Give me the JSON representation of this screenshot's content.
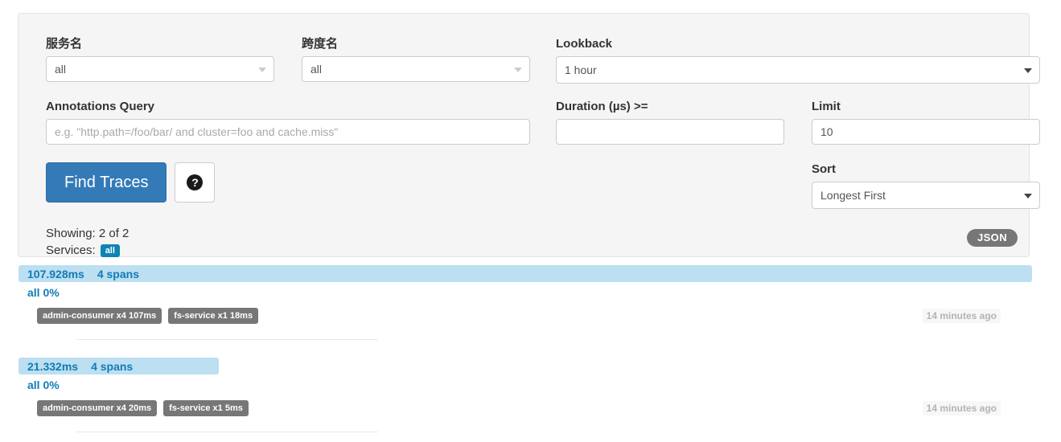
{
  "search_form": {
    "service_name": {
      "label": "服务名",
      "value": "all"
    },
    "span_name": {
      "label": "跨度名",
      "value": "all"
    },
    "lookback": {
      "label": "Lookback",
      "value": "1 hour"
    },
    "annotations_query": {
      "label": "Annotations Query",
      "value": "",
      "placeholder": "e.g. \"http.path=/foo/bar/ and cluster=foo and cache.miss\""
    },
    "duration": {
      "label": "Duration (µs) >=",
      "value": "",
      "placeholder": ""
    },
    "limit": {
      "label": "Limit",
      "value": "10"
    },
    "sort": {
      "label": "Sort",
      "value": "Longest First"
    },
    "find_traces_button": "Find Traces",
    "help_button_icon": "question-circle-icon",
    "help_button_glyph": "?"
  },
  "results_summary": {
    "showing": "Showing: 2 of 2",
    "services_label": "Services:",
    "services_badges": [
      "all"
    ],
    "json_button": "JSON"
  },
  "traces": [
    {
      "duration": "107.928ms",
      "spans": "4 spans",
      "percent_label": "all 0%",
      "services": [
        "admin-consumer x4 107ms",
        "fs-service x1 18ms"
      ],
      "timestamp": "14 minutes ago"
    },
    {
      "duration": "21.332ms",
      "spans": "4 spans",
      "percent_label": "all 0%",
      "services": [
        "admin-consumer x4 20ms",
        "fs-service x1 5ms"
      ],
      "timestamp": "14 minutes ago"
    }
  ],
  "colors": {
    "primary_button": "#337ab7",
    "panel_background": "#f5f5f5",
    "trace_bar": "#bcdff1",
    "trace_text": "#137bb5",
    "service_badge": "#777777",
    "services_badge": "#0e84b5"
  }
}
